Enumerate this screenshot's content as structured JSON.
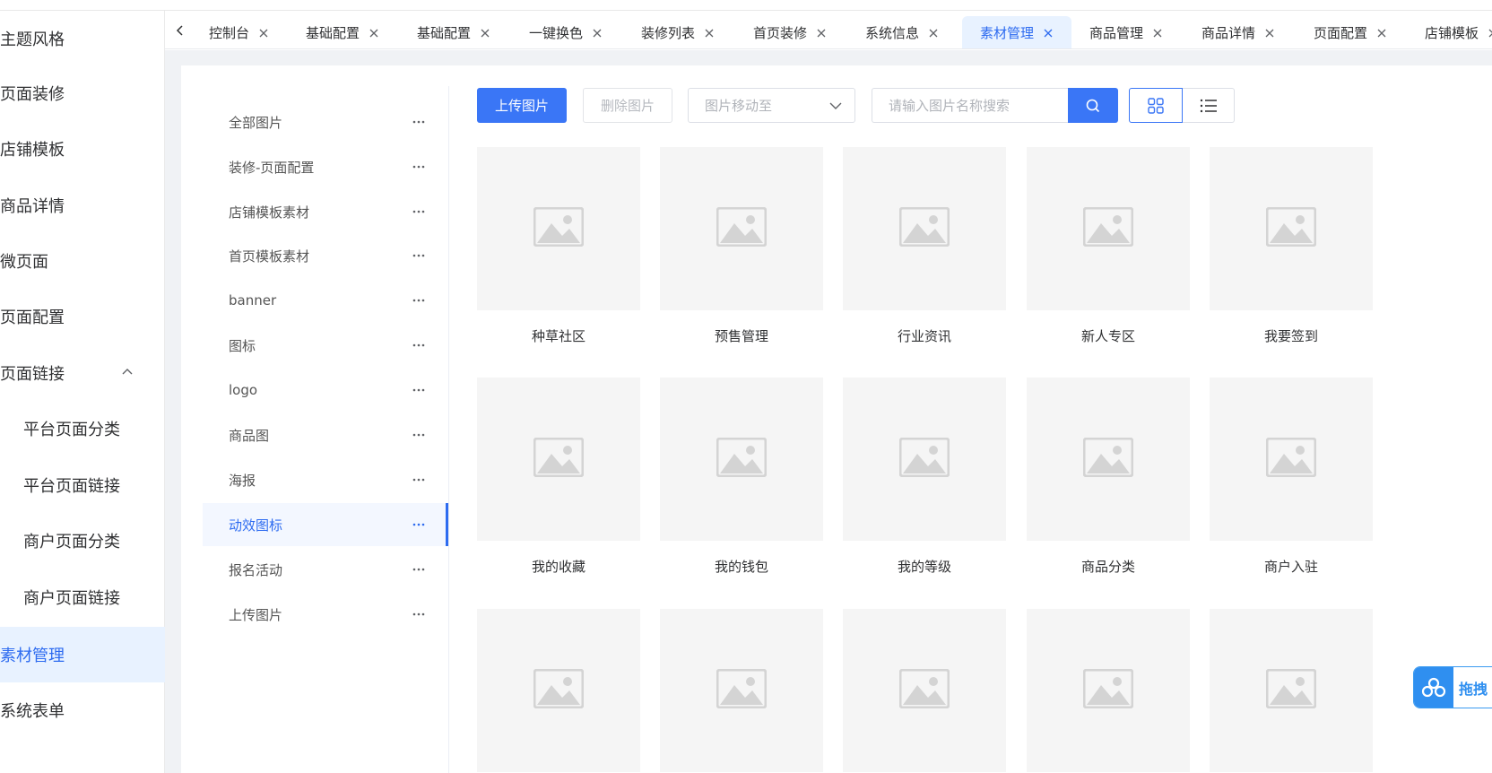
{
  "sidebar": {
    "items": [
      {
        "label": "主题风格"
      },
      {
        "label": "页面装修"
      },
      {
        "label": "店铺模板"
      },
      {
        "label": "商品详情"
      },
      {
        "label": "微页面"
      },
      {
        "label": "页面配置"
      },
      {
        "label": "页面链接",
        "expanded": true
      },
      {
        "label": "平台页面分类"
      },
      {
        "label": "平台页面链接"
      },
      {
        "label": "商户页面分类"
      },
      {
        "label": "商户页面链接"
      },
      {
        "label": "素材管理",
        "active": true
      },
      {
        "label": "系统表单"
      }
    ]
  },
  "tabs": [
    {
      "label": "控制台"
    },
    {
      "label": "基础配置"
    },
    {
      "label": "基础配置"
    },
    {
      "label": "一键换色"
    },
    {
      "label": "装修列表"
    },
    {
      "label": "首页装修"
    },
    {
      "label": "系统信息"
    },
    {
      "label": "素材管理",
      "active": true
    },
    {
      "label": "商品管理"
    },
    {
      "label": "商品详情"
    },
    {
      "label": "页面配置"
    },
    {
      "label": "店铺模板"
    }
  ],
  "categories": [
    {
      "label": "全部图片"
    },
    {
      "label": "装修-页面配置"
    },
    {
      "label": "店铺模板素材"
    },
    {
      "label": "首页模板素材"
    },
    {
      "label": "banner"
    },
    {
      "label": "图标"
    },
    {
      "label": "logo"
    },
    {
      "label": "商品图"
    },
    {
      "label": "海报"
    },
    {
      "label": "动效图标",
      "active": true
    },
    {
      "label": "报名活动"
    },
    {
      "label": "上传图片"
    }
  ],
  "toolbar": {
    "upload_label": "上传图片",
    "delete_label": "删除图片",
    "move_placeholder": "图片移动至",
    "search_placeholder": "请输入图片名称搜索"
  },
  "images": [
    {
      "name": "种草社区"
    },
    {
      "name": "预售管理"
    },
    {
      "name": "行业资讯"
    },
    {
      "name": "新人专区"
    },
    {
      "name": "我要签到"
    },
    {
      "name": "我的收藏"
    },
    {
      "name": "我的钱包"
    },
    {
      "name": "我的等级"
    },
    {
      "name": "商品分类"
    },
    {
      "name": "商户入驻"
    },
    {
      "name": ""
    },
    {
      "name": ""
    },
    {
      "name": ""
    },
    {
      "name": ""
    },
    {
      "name": ""
    }
  ],
  "float_widget": {
    "label": "拖拽"
  },
  "colors": {
    "accent": "#3a76f6",
    "active_bg": "#e8f2ff",
    "thumb_bg": "#f5f5f5"
  }
}
